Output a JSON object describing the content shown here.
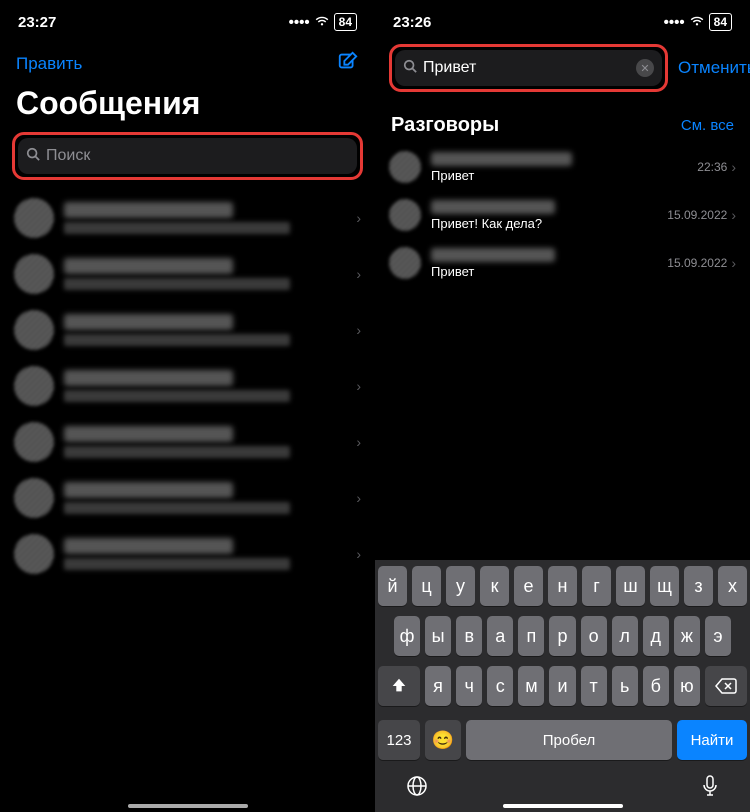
{
  "status": {
    "time_left": "23:27",
    "time_right": "23:26",
    "battery": "84"
  },
  "left": {
    "edit": "Править",
    "title": "Сообщения",
    "search_placeholder": "Поиск",
    "conversations": [
      {
        "name": "",
        "preview": "",
        "time": ""
      },
      {
        "name": "",
        "preview": "",
        "time": ""
      },
      {
        "name": "",
        "preview": "",
        "time": ""
      },
      {
        "name": "",
        "preview": "",
        "time": ""
      },
      {
        "name": "",
        "preview": "",
        "time": ""
      },
      {
        "name": "",
        "preview": "",
        "time": ""
      },
      {
        "name": "",
        "preview": "",
        "time": ""
      }
    ]
  },
  "right": {
    "search_value": "Привет",
    "cancel": "Отменить",
    "section_title": "Разговоры",
    "see_all": "См. все",
    "results": [
      {
        "name": "",
        "preview": "Привет",
        "time": "22:36"
      },
      {
        "name": "",
        "preview": "Привет! Как дела?",
        "time": "15.09.2022"
      },
      {
        "name": "",
        "preview": "Привет",
        "time": "15.09.2022"
      }
    ]
  },
  "keyboard": {
    "row1": [
      "й",
      "ц",
      "у",
      "к",
      "е",
      "н",
      "г",
      "ш",
      "щ",
      "з",
      "х"
    ],
    "row2": [
      "ф",
      "ы",
      "в",
      "а",
      "п",
      "р",
      "о",
      "л",
      "д",
      "ж",
      "э"
    ],
    "row3": [
      "я",
      "ч",
      "с",
      "м",
      "и",
      "т",
      "ь",
      "б",
      "ю"
    ],
    "num": "123",
    "space": "Пробел",
    "find": "Найти"
  }
}
